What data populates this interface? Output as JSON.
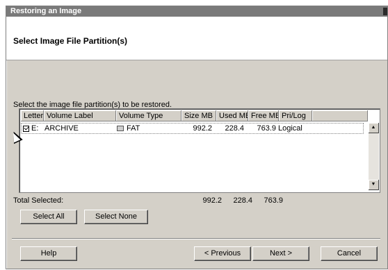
{
  "window": {
    "title": "Restoring an Image"
  },
  "header": {
    "heading": "Select Image File Partition(s)"
  },
  "instruction": "Select the image file partition(s) to be restored.",
  "table": {
    "columns": [
      "Letter",
      "Volume Label",
      "Volume Type",
      "Size MB",
      "Used MB",
      "Free MB",
      "Pri/Log"
    ],
    "rows": [
      {
        "checked": true,
        "letter": "E:",
        "volume_label": "ARCHIVE",
        "volume_type": "FAT",
        "size_mb": "992.2",
        "used_mb": "228.4",
        "free_mb": "763.9",
        "pri_log": "Logical"
      }
    ]
  },
  "totals": {
    "label": "Total Selected:",
    "size_mb": "992.2",
    "used_mb": "228.4",
    "free_mb": "763.9"
  },
  "buttons": {
    "select_all": "Select All",
    "select_none": "Select None",
    "help": "Help",
    "previous": "< Previous",
    "next": "Next >",
    "cancel": "Cancel"
  },
  "icons": {
    "drive": "drive-icon",
    "scroll_up": "scroll-up-icon",
    "scroll_down": "scroll-down-icon"
  }
}
